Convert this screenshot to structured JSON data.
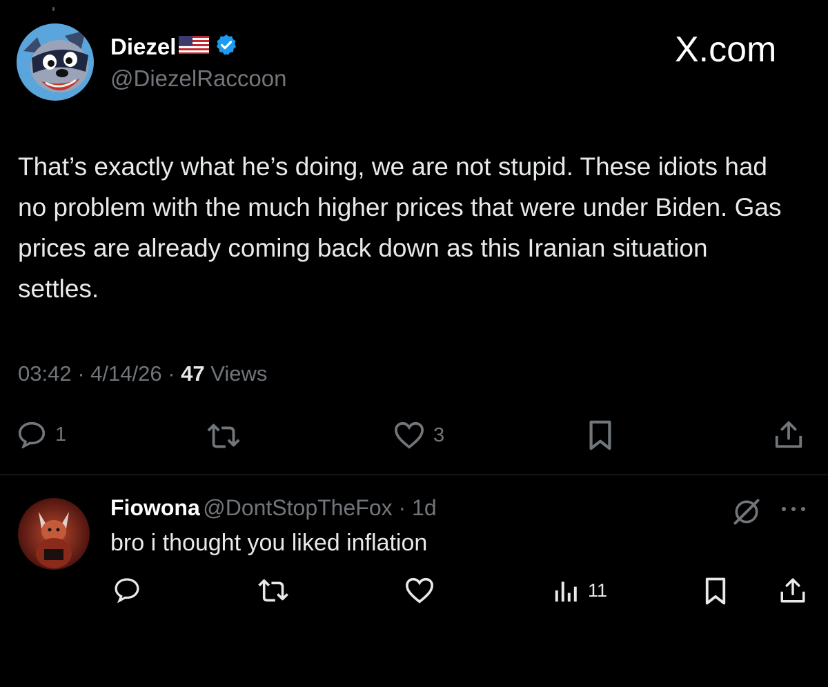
{
  "watermark": "X.com",
  "tweet": {
    "display_name": "Diezel",
    "handle": "@DiezelRaccoon",
    "text": "That’s exactly what he’s doing, we are not stupid. These idiots had no problem with the much higher prices that were under Biden. Gas prices are already coming back down as this Iranian situation settles.",
    "time": "03:42",
    "date": "4/14/26",
    "views_count": "47",
    "views_label": "Views",
    "reply_count": "1",
    "like_count": "3",
    "colors": {
      "verified": "#1d9bf0",
      "muted": "#71767b"
    }
  },
  "reply": {
    "display_name": "Fiowona",
    "handle": "@DontStopTheFox",
    "age": "1d",
    "text": "bro i thought you liked inflation",
    "views_count": "11"
  }
}
